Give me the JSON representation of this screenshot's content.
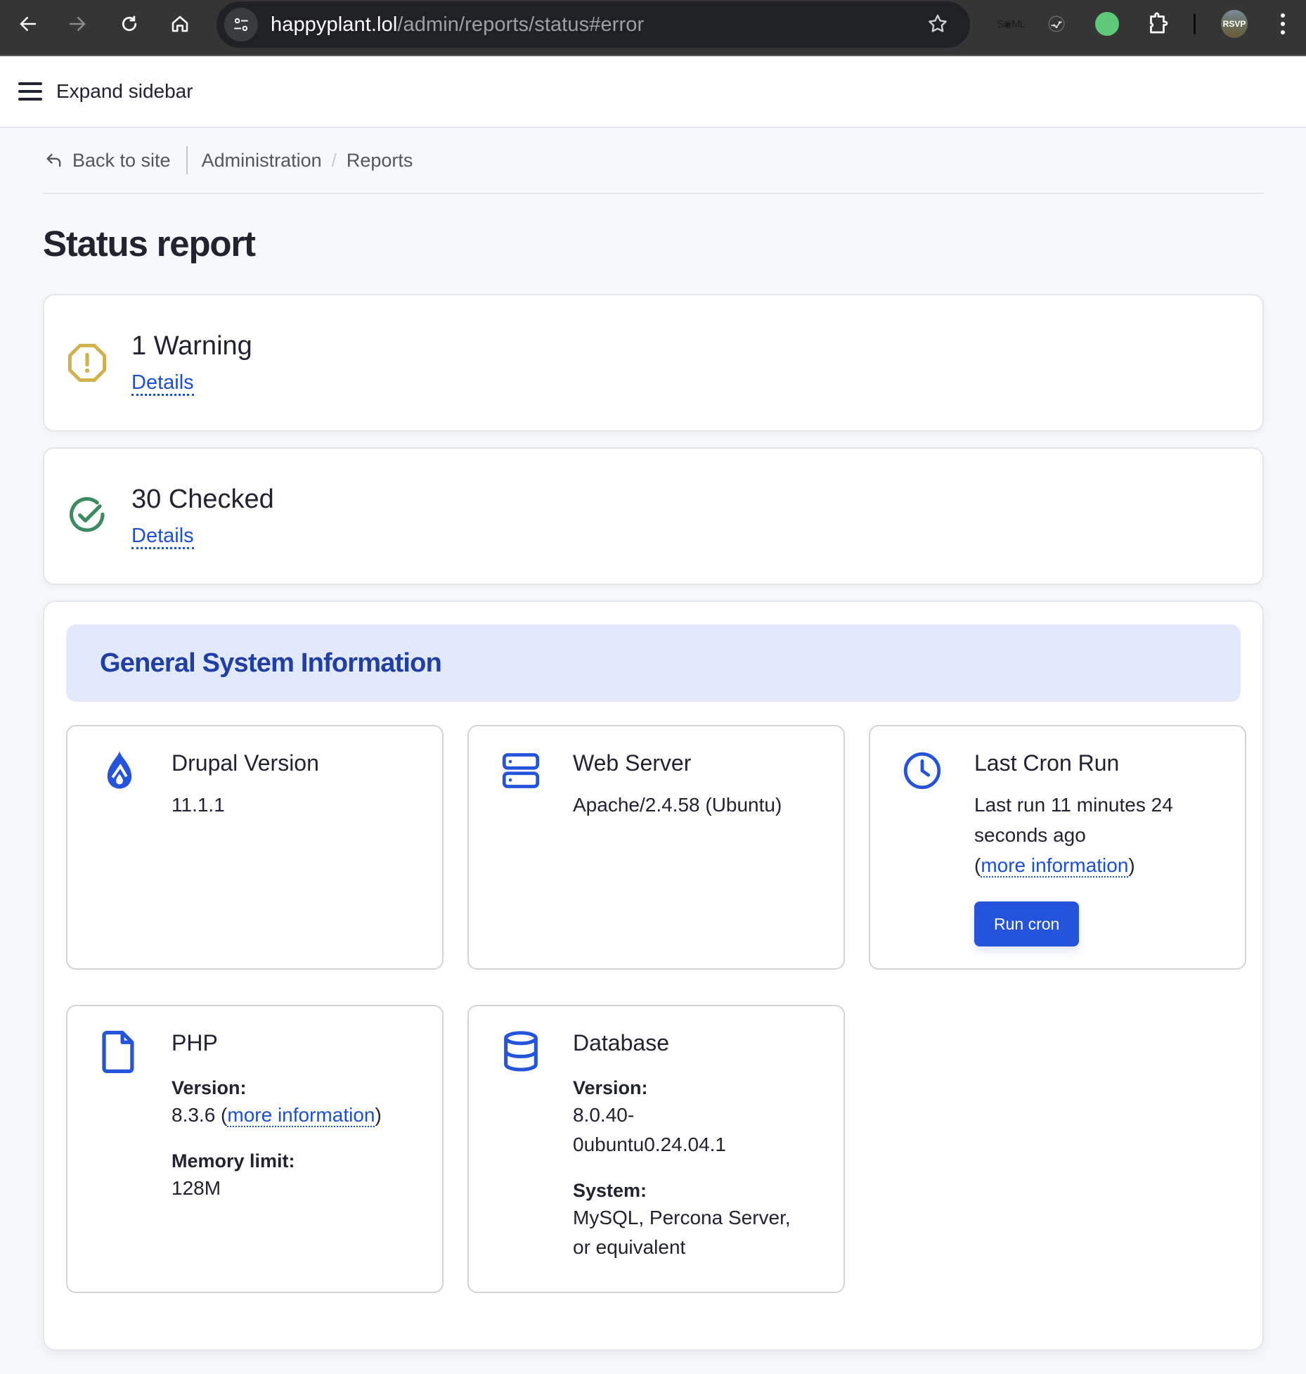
{
  "browser": {
    "url_host": "happyplant.lol",
    "url_path": "/admin/reports/status#error",
    "extensions": [
      "saml-lock-extension",
      "graph-extension",
      "green-status-extension",
      "puzzle-extensions-icon"
    ],
    "profile_label": "RSVP"
  },
  "topbar": {
    "expand_label": "Expand sidebar"
  },
  "breadcrumb": {
    "back_label": "Back to site",
    "items": [
      "Administration",
      "Reports"
    ],
    "separator": "/"
  },
  "page": {
    "title": "Status report"
  },
  "status_cards": [
    {
      "title": "1 Warning",
      "link": "Details",
      "icon": "warning-octagon-icon",
      "color": "#d4b04a"
    },
    {
      "title": "30 Checked",
      "link": "Details",
      "icon": "check-circle-icon",
      "color": "#3b8a62"
    }
  ],
  "general": {
    "heading": "General System Information",
    "drupal": {
      "title": "Drupal Version",
      "value": "11.1.1"
    },
    "web_server": {
      "title": "Web Server",
      "value": "Apache/2.4.58 (Ubuntu)"
    },
    "cron": {
      "title": "Last Cron Run",
      "text": "Last run 11 minutes 24 seconds ago",
      "open_paren": "(",
      "link": "more information",
      "close_paren": ")",
      "button": "Run cron"
    },
    "php": {
      "title": "PHP",
      "version_label": "Version:",
      "version_value": "8.3.6 (",
      "version_link": "more information",
      "version_close": ")",
      "memory_label": "Memory limit:",
      "memory_value": "128M"
    },
    "database": {
      "title": "Database",
      "version_label": "Version:",
      "version_value": "8.0.40-0ubuntu0.24.04.1",
      "system_label": "System:",
      "system_value": "MySQL, Percona Server, or equivalent"
    }
  },
  "colors": {
    "accent": "#2354db",
    "link": "#1a4fd6",
    "warning": "#d4b04a",
    "ok": "#3b8a62",
    "header_bg": "#e1e9fa",
    "header_text": "#1f3ea6"
  }
}
